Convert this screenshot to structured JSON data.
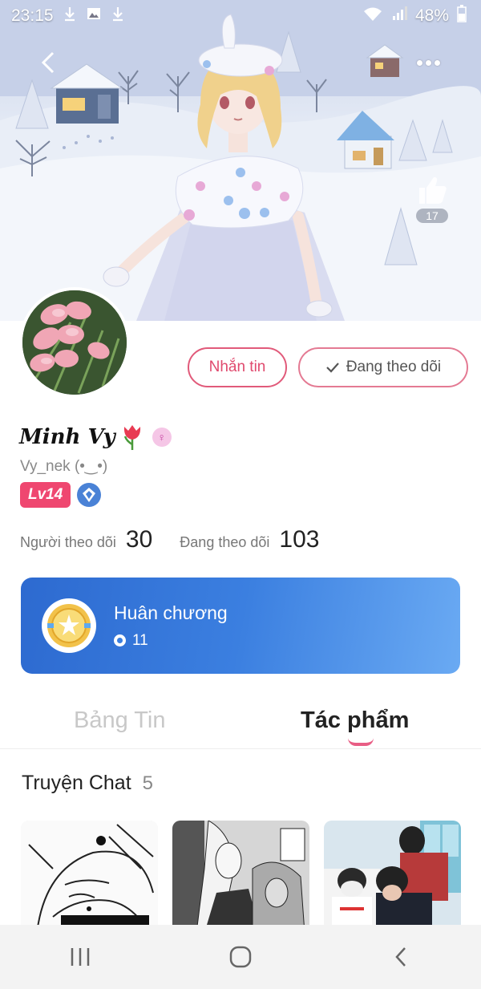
{
  "status_bar": {
    "time": "23:15",
    "battery": "48%"
  },
  "header": {
    "likes": "17"
  },
  "actions": {
    "message_label": "Nhắn tin",
    "following_label": "Đang theo dõi"
  },
  "profile": {
    "name": "Minh Vy",
    "handle": "Vy_nek (•‿•)",
    "level": "Lv14"
  },
  "stats": {
    "followers_label": "Người theo dõi",
    "followers_value": "30",
    "following_label": "Đang theo dõi",
    "following_value": "103"
  },
  "medal": {
    "title": "Huân chương",
    "count": "11"
  },
  "tabs": [
    {
      "label": "Bảng Tin",
      "active": false
    },
    {
      "label": "Tác phẩm",
      "active": true
    }
  ],
  "section": {
    "title": "Truyện Chat",
    "count": "5"
  },
  "colors": {
    "accent": "#e04a6e",
    "medal_card": "#3b7fe0",
    "level_badge": "#ef4770"
  },
  "icons": [
    "back-arrow-icon",
    "more-icon",
    "thumbs-up-icon",
    "download-icon",
    "image-icon",
    "wifi-icon",
    "signal-icon",
    "battery-icon",
    "check-icon",
    "tulip-icon",
    "gender-icon",
    "gem-icon",
    "medal-icon",
    "recent-apps-icon",
    "home-icon",
    "back-icon"
  ]
}
